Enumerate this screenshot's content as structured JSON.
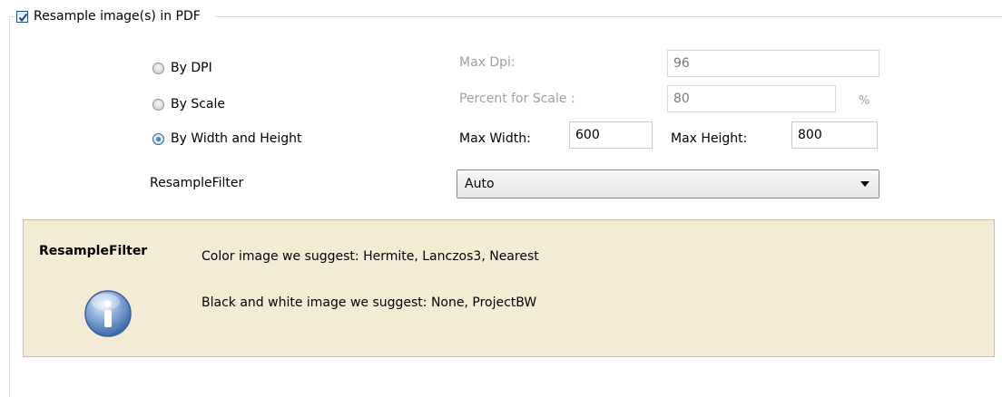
{
  "group": {
    "checked": true,
    "label": "Resample image(s) in PDF"
  },
  "radios": [
    {
      "label": "By DPI",
      "checked": false
    },
    {
      "label": "By Scale",
      "checked": false
    },
    {
      "label": "By Width and Height",
      "checked": true
    }
  ],
  "max_dpi": {
    "label": "Max Dpi:",
    "value": "96",
    "enabled": false
  },
  "percent_scale": {
    "label": "Percent for Scale :",
    "value": "80",
    "unit": "%",
    "enabled": false
  },
  "max_width": {
    "label": "Max Width:",
    "value": "600"
  },
  "max_height": {
    "label": "Max Height:",
    "value": "800"
  },
  "resample_filter": {
    "label": "ResampleFilter",
    "selected": "Auto"
  },
  "info": {
    "title": "ResampleFilter",
    "line1": "Color image we suggest: Hermite, Lanczos3, Nearest",
    "line2": "Black and white image we suggest: None, ProjectBW",
    "icon": "info-icon"
  }
}
